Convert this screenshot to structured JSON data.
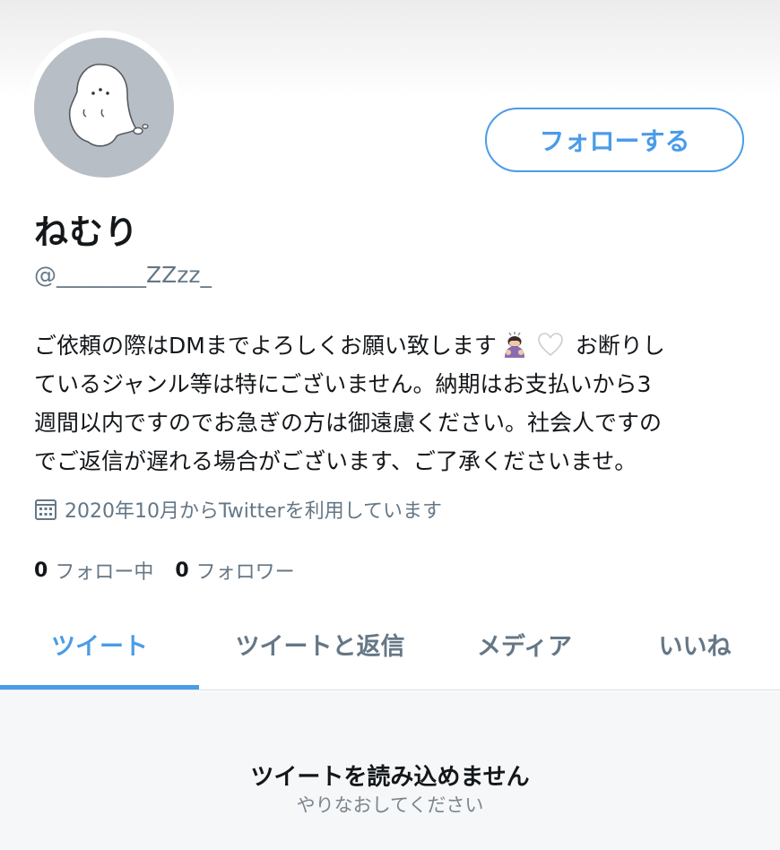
{
  "profile": {
    "display_name": "ねむり",
    "handle": "@________ZZzz_",
    "follow_button": "フォローする",
    "avatar_icon": "ghost-avatar",
    "bio_lines": [
      {
        "before": "ご依頼の際はDMまでよろしくお願い致します",
        "after": " お断りし"
      },
      {
        "text": "ているジャンル等は特にございません。納期はお支払いから3"
      },
      {
        "text": "週間以内ですのでお急ぎの方は御遠慮ください。社会人ですの"
      },
      {
        "text": "でご返信が遅れる場合がございます、ご了承くださいませ。"
      }
    ],
    "bio_emojis": [
      "person-bowing-emoji",
      "white-heart-emoji"
    ],
    "joined": "2020年10月からTwitterを利用しています",
    "joined_icon": "calendar-icon",
    "following_count": "0",
    "following_label": "フォロー中",
    "followers_count": "0",
    "followers_label": "フォロワー"
  },
  "tabs": [
    {
      "label": "ツイート",
      "active": true
    },
    {
      "label": "ツイートと返信",
      "active": false
    },
    {
      "label": "メディア",
      "active": false
    },
    {
      "label": "いいね",
      "active": false
    }
  ],
  "empty_state": {
    "title": "ツイートを読み込めません",
    "retry": "やりなおしてください"
  },
  "colors": {
    "accent": "#4a9ce8",
    "secondary_text": "#657786",
    "avatar_bg": "#b8bec5"
  }
}
